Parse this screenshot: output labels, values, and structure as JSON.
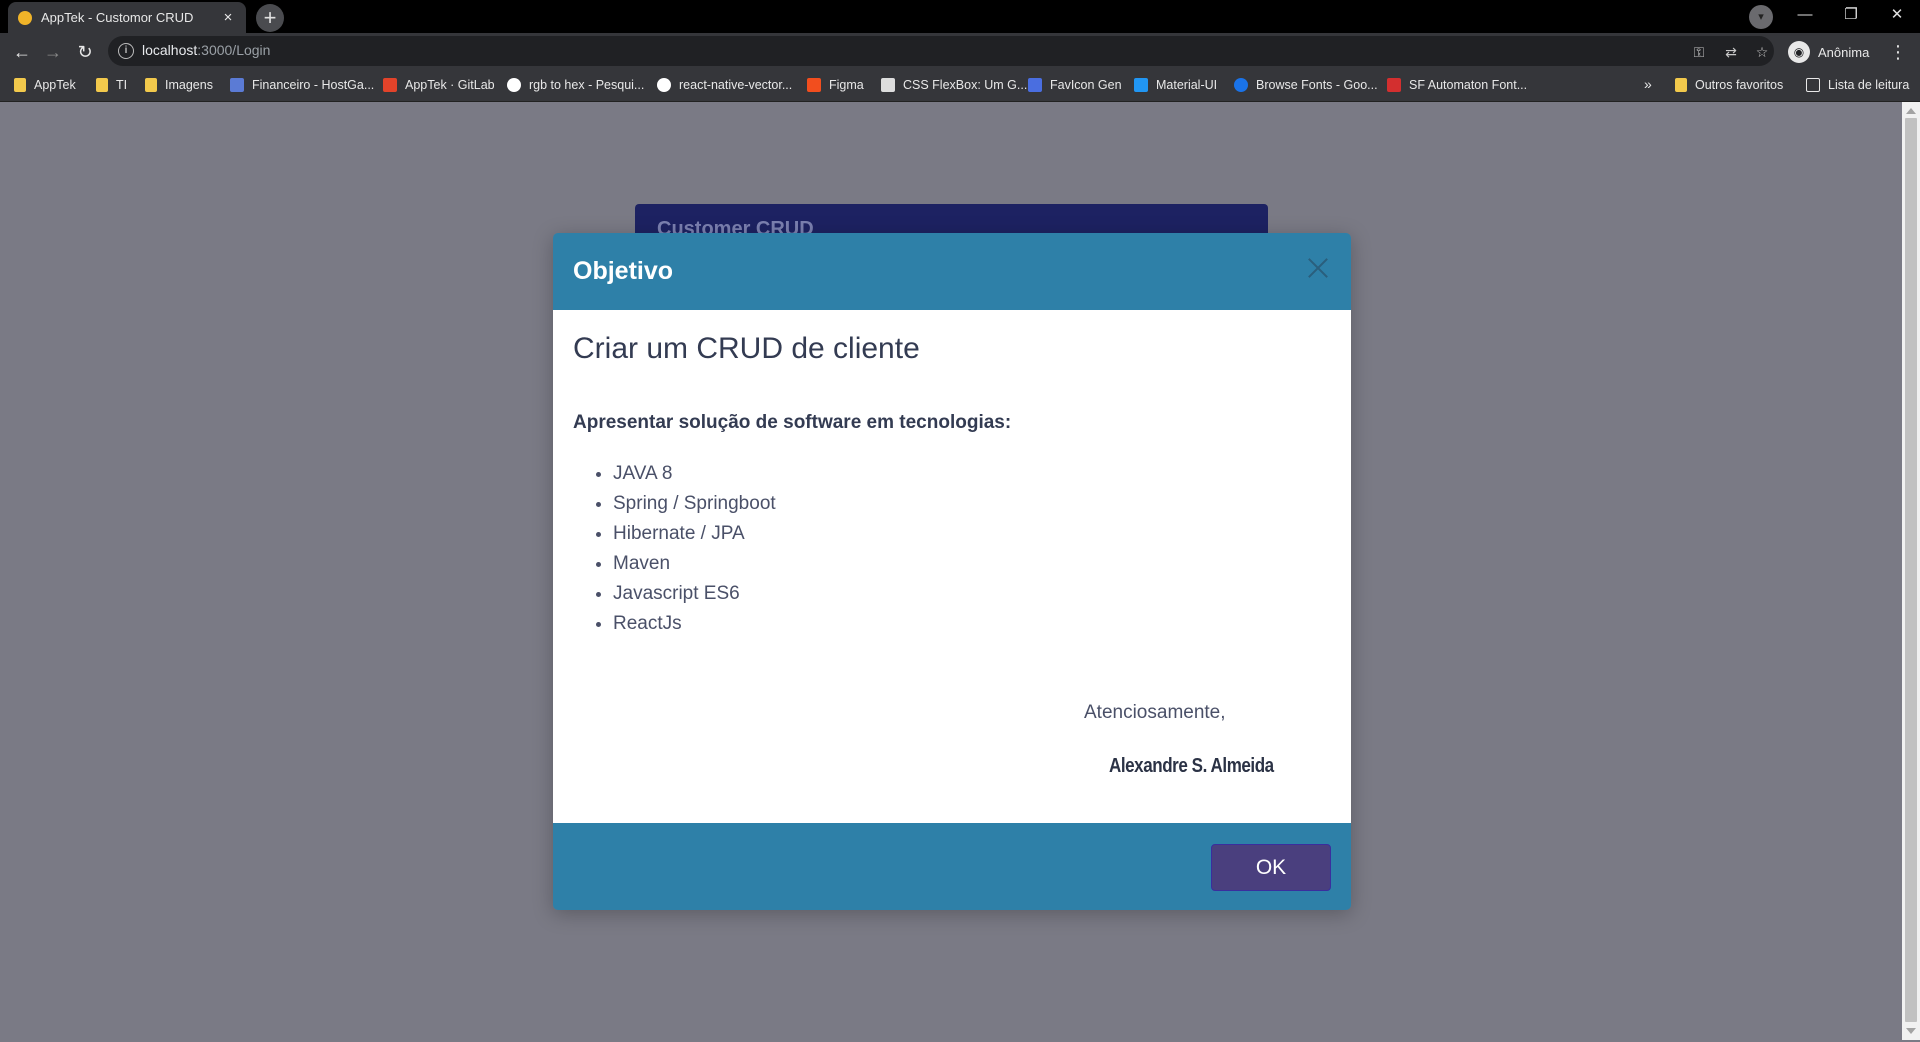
{
  "browser": {
    "tab_title": "AppTek - Customor CRUD",
    "tab_close": "×",
    "new_tab": "+",
    "url_host": "localhost",
    "url_path": ":3000/Login",
    "profile_label": "Anônima",
    "bookmarks": [
      {
        "label": "AppTek",
        "icon": "folder-icon",
        "color": "#f2c94c"
      },
      {
        "label": "TI",
        "icon": "folder-icon",
        "color": "#f2c94c"
      },
      {
        "label": "Imagens",
        "icon": "folder-icon",
        "color": "#f2c94c"
      },
      {
        "label": "Financeiro - HostGa...",
        "icon": "hostgator-icon",
        "color": "#5b7bd5"
      },
      {
        "label": "AppTek · GitLab",
        "icon": "gitlab-icon",
        "color": "#e2432a"
      },
      {
        "label": "rgb to hex - Pesqui...",
        "icon": "google-icon",
        "color": "#ffffff"
      },
      {
        "label": "react-native-vector...",
        "icon": "github-icon",
        "color": "#ffffff"
      },
      {
        "label": "Figma",
        "icon": "figma-icon",
        "color": "#f24e1e"
      },
      {
        "label": "CSS FlexBox: Um G...",
        "icon": "a-icon",
        "color": "#ffffff"
      },
      {
        "label": "FavIcon Gen",
        "icon": "favicon-gen-icon",
        "color": "#4a6ee0"
      },
      {
        "label": "Material-UI",
        "icon": "material-ui-icon",
        "color": "#2196f3"
      },
      {
        "label": "Browse Fonts - Goo...",
        "icon": "google-fonts-icon",
        "color": "#1a73e8"
      },
      {
        "label": "SF Automaton Font...",
        "icon": "fonts-f-icon",
        "color": "#d32f2f"
      }
    ],
    "bookmarks_more": "»",
    "other_bookmarks": "Outros favoritos",
    "reading_list": "Lista de leitura"
  },
  "background_card": {
    "title": "Customer CRUD"
  },
  "modal": {
    "title": "Objetivo",
    "heading": "Criar um CRUD de cliente",
    "subheading": "Apresentar solução de software em tecnologias:",
    "technologies": [
      "JAVA 8",
      "Spring / Springboot",
      "Hibernate / JPA",
      "Maven",
      "Javascript ES6",
      "ReactJs"
    ],
    "regards": "Atenciosamente,",
    "signature": "Alexandre S. Almeida",
    "ok_label": "OK"
  },
  "colors": {
    "modal_header": "#2e80a8",
    "ok_button": "#4a3f7e",
    "overlay": "#7a7a85",
    "background_card": "#1d2262"
  }
}
